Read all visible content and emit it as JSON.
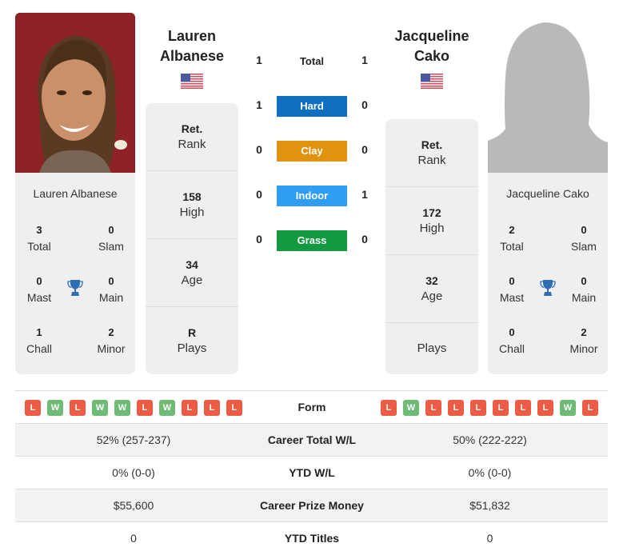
{
  "colors": {
    "hard": "#0f6fbf",
    "clay": "#e0930e",
    "indoor": "#2f9df0",
    "grass": "#13993f",
    "win": "#6dbb74",
    "loss": "#ec5b44",
    "trophy": "#2f6db5"
  },
  "player1": {
    "name_line1": "Lauren",
    "name_line2": "Albanese",
    "full_name": "Lauren Albanese",
    "flag": "us-flag-icon",
    "titles": {
      "total": "3",
      "total_label": "Total",
      "slam": "0",
      "slam_label": "Slam",
      "mast": "0",
      "mast_label": "Mast",
      "main": "0",
      "main_label": "Main",
      "chall": "1",
      "chall_label": "Chall",
      "minor": "2",
      "minor_label": "Minor"
    },
    "info": {
      "rank_value": "Ret.",
      "rank_label": "Rank",
      "high_value": "158",
      "high_label": "High",
      "age_value": "34",
      "age_label": "Age",
      "plays_value": "R",
      "plays_label": "Plays"
    },
    "form": [
      "L",
      "W",
      "L",
      "W",
      "W",
      "L",
      "W",
      "L",
      "L",
      "L"
    ],
    "career_wl": "52% (257-237)",
    "ytd_wl": "0% (0-0)",
    "prize_money": "$55,600",
    "ytd_titles": "0"
  },
  "player2": {
    "name_line1": "Jacqueline",
    "name_line2": "Cako",
    "full_name": "Jacqueline Cako",
    "flag": "us-flag-icon",
    "titles": {
      "total": "2",
      "total_label": "Total",
      "slam": "0",
      "slam_label": "Slam",
      "mast": "0",
      "mast_label": "Mast",
      "main": "0",
      "main_label": "Main",
      "chall": "0",
      "chall_label": "Chall",
      "minor": "2",
      "minor_label": "Minor"
    },
    "info": {
      "rank_value": "Ret.",
      "rank_label": "Rank",
      "high_value": "172",
      "high_label": "High",
      "age_value": "32",
      "age_label": "Age",
      "plays_value": "",
      "plays_label": "Plays"
    },
    "form": [
      "L",
      "W",
      "L",
      "L",
      "L",
      "L",
      "L",
      "L",
      "W",
      "L"
    ],
    "career_wl": "50% (222-222)",
    "ytd_wl": "0% (0-0)",
    "prize_money": "$51,832",
    "ytd_titles": "0"
  },
  "h2h": {
    "total_label": "Total",
    "p1_total": "1",
    "p2_total": "1",
    "surfaces": [
      {
        "label": "Hard",
        "p1": "1",
        "p2": "0"
      },
      {
        "label": "Clay",
        "p1": "0",
        "p2": "0"
      },
      {
        "label": "Indoor",
        "p1": "0",
        "p2": "1"
      },
      {
        "label": "Grass",
        "p1": "0",
        "p2": "0"
      }
    ]
  },
  "table": {
    "form_label": "Form",
    "career_wl_label": "Career Total W/L",
    "ytd_wl_label": "YTD W/L",
    "prize_label": "Career Prize Money",
    "ytd_titles_label": "YTD Titles"
  }
}
